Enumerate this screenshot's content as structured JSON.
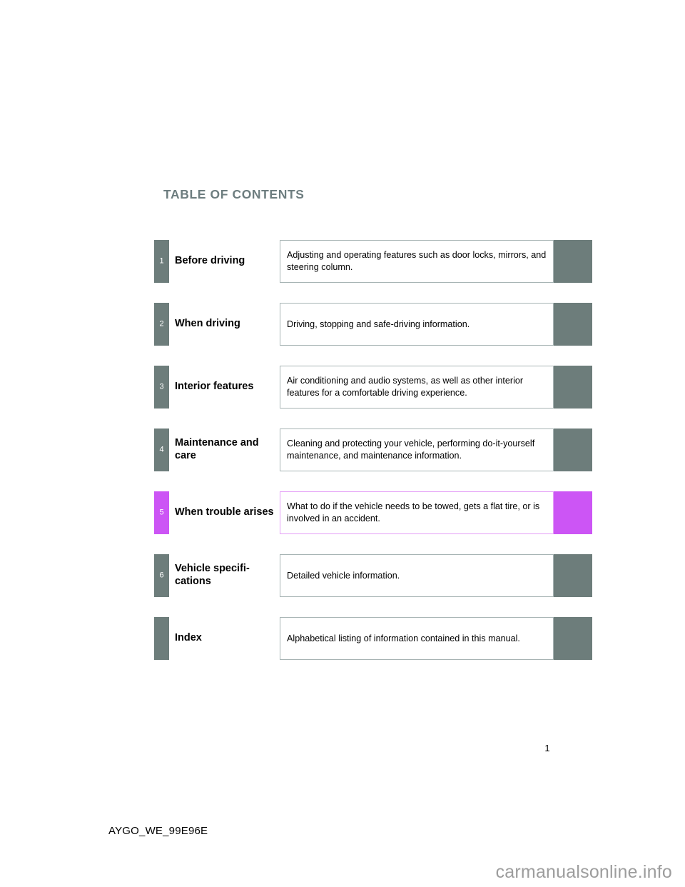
{
  "page": {
    "title": "TABLE OF CONTENTS",
    "page_number": "1",
    "document_code": "AYGO_WE_99E96E",
    "watermark": "carmanualsonline.info",
    "accent_color": "#6d7d7b",
    "highlight_color": "#cc55f5",
    "title_color": "#6d7d7f",
    "box_border_color": "#a7b4b4",
    "highlight_border_color": "#e49ff7"
  },
  "toc": {
    "rows": [
      {
        "number": "1",
        "chapter": "Before driving",
        "description": "Adjusting and operating features such as door locks, mirrors, and steering column.",
        "highlighted": false
      },
      {
        "number": "2",
        "chapter": "When driving",
        "description": "Driving, stopping and safe-driving information.",
        "highlighted": false
      },
      {
        "number": "3",
        "chapter": "Interior features",
        "description": "Air conditioning and audio systems, as well as other interior features for a comfortable driving experience.",
        "highlighted": false
      },
      {
        "number": "4",
        "chapter": "Maintenance and care",
        "description": "Cleaning and protecting your vehicle, performing do-it-yourself maintenance, and maintenance information.",
        "highlighted": false
      },
      {
        "number": "5",
        "chapter": "When trouble arises",
        "description": "What to do if the vehicle needs to be towed, gets a flat tire, or is involved in an accident.",
        "highlighted": true
      },
      {
        "number": "6",
        "chapter": "Vehicle specifi-cations",
        "description": "Detailed vehicle information.",
        "highlighted": false
      },
      {
        "number": "",
        "chapter": "Index",
        "description": "Alphabetical listing of information contained in this manual.",
        "highlighted": false
      }
    ]
  }
}
